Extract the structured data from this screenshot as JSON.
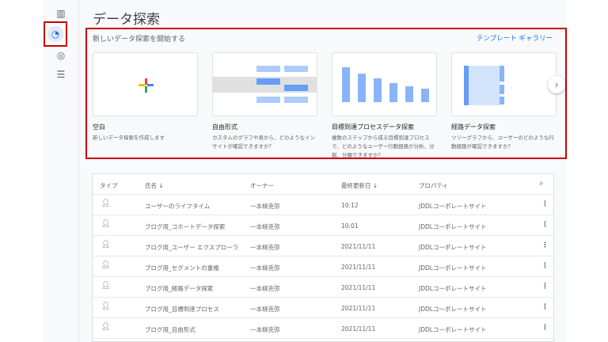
{
  "page_title": "データ探索",
  "rail": {
    "icons": [
      "bar-chart-icon",
      "explore-icon",
      "ads-icon",
      "table-icon"
    ]
  },
  "section": {
    "heading": "新しいデータ探索を開始する",
    "gallery_link": "テンプレート ギャラリー"
  },
  "cards": [
    {
      "name": "空白",
      "desc": "新しいデータ探索を作成します"
    },
    {
      "name": "自由形式",
      "desc": "カスタムのグラフや表から、どのようなインサイトが確認できますか？"
    },
    {
      "name": "目標到達プロセスデータ探索",
      "desc": "複数のステップから成る目標到達プロセスで、どのようなユーザー行動経路が分析、分割、分類できますか？"
    },
    {
      "name": "経路データ探索",
      "desc": "ツリーグラフから、ユーザーのどのような行動経路が確認できますか？"
    }
  ],
  "table": {
    "headers": {
      "type": "タイプ",
      "name": "氏名",
      "owner": "オーナー",
      "modified": "最終更新日",
      "property": "プロパティ"
    },
    "rows": [
      {
        "name": "ユーザーのライフタイム",
        "owner": "一本柳克弥",
        "modified": "10:12",
        "property": "JDDLコーポレートサイト"
      },
      {
        "name": "ブログ用_コホートデータ探索",
        "owner": "一本柳克弥",
        "modified": "10:01",
        "property": "JDDLコーポレートサイト"
      },
      {
        "name": "ブログ用_ユーザー エクスプローラ",
        "owner": "一本柳克弥",
        "modified": "2021/11/11",
        "property": "JDDLコーポレートサイト"
      },
      {
        "name": "ブログ用_セグメントの重複",
        "owner": "一本柳克弥",
        "modified": "2021/11/11",
        "property": "JDDLコーポレートサイト"
      },
      {
        "name": "ブログ用_経路データ探索",
        "owner": "一本柳克弥",
        "modified": "2021/11/11",
        "property": "JDDLコーポレートサイト"
      },
      {
        "name": "ブログ用_目標到達プロセス",
        "owner": "一本柳克弥",
        "modified": "2021/11/11",
        "property": "JDDLコーポレートサイト"
      },
      {
        "name": "ブログ用_自由形式",
        "owner": "一本柳克弥",
        "modified": "2021/11/11",
        "property": "JDDLコーポレートサイト"
      }
    ]
  }
}
